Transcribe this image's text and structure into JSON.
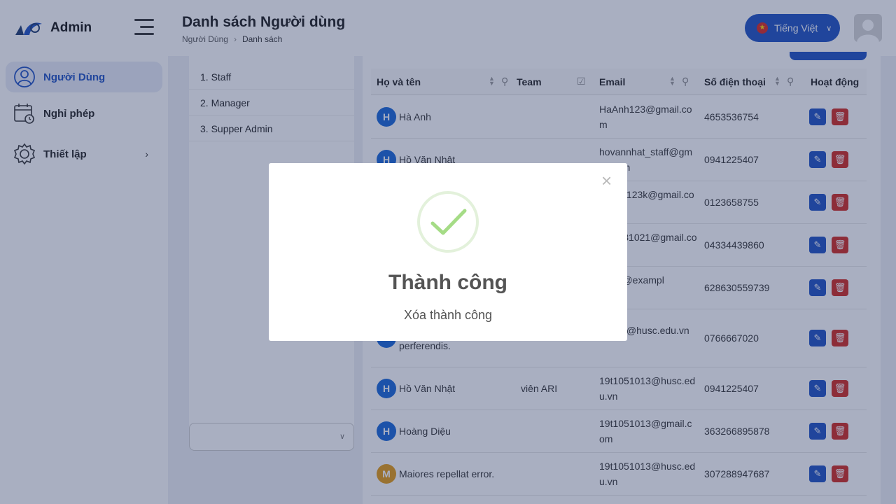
{
  "app": {
    "brand": "Admin"
  },
  "sidebar": {
    "items": [
      {
        "label": "Người Dùng",
        "icon": "user-icon"
      },
      {
        "label": "Nghỉ phép",
        "icon": "calendar-icon"
      },
      {
        "label": "Thiết lập",
        "icon": "gear-icon"
      }
    ]
  },
  "header": {
    "title": "Danh sách Người dùng",
    "breadcrumb": {
      "parent": "Người Dùng",
      "current": "Danh sách"
    },
    "language": "Tiếng Việt"
  },
  "roles": [
    "1. Staff",
    "2. Manager",
    "3. Supper Admin"
  ],
  "table": {
    "columns": [
      "Họ và tên",
      "Team",
      "Email",
      "Số điện thoại",
      "Hoạt động"
    ],
    "rows": [
      {
        "initial": "H",
        "name": "Hà Anh",
        "team": "",
        "email": "HaAnh123@gmail.com",
        "phone": "4653536754"
      },
      {
        "initial": "H",
        "name": "Hồ Văn Nhật",
        "team": "",
        "email": "hovannhat_staff@gmail.com",
        "phone": "0941225407"
      },
      {
        "initial": "",
        "name": "",
        "team": "",
        "email": "nhung123k@gmail.com",
        "phone": "0123658755"
      },
      {
        "initial": "",
        "name": "",
        "team": "",
        "email": "dieu181021@gmail.com",
        "phone": "04334439860"
      },
      {
        "initial": "",
        "name": "",
        "team": "",
        "email": "ibhav@exampl",
        "phone": "628630559739"
      },
      {
        "initial": "",
        "name": "perferendis.",
        "team": "",
        "email": "51013@husc.edu.vn",
        "phone": "0766667020"
      },
      {
        "initial": "H",
        "name": "Hồ Văn Nhật",
        "team": "viên ARI",
        "email": "19t1051013@husc.edu.vn",
        "phone": "0941225407"
      },
      {
        "initial": "H",
        "name": "Hoàng Diệu",
        "team": "",
        "email": "19t1051013@gmail.com",
        "phone": "363266895878"
      },
      {
        "initial": "M",
        "name": "Maiores repellat error.",
        "team": "",
        "email": "19t1051013@husc.edu.vn",
        "phone": "307288947687"
      }
    ]
  },
  "modal": {
    "title": "Thành công",
    "message": "Xóa thành công",
    "close": "×"
  },
  "colors": {
    "primary": "#1c4fc2",
    "danger": "#d0271d",
    "success": "#a5dc86",
    "avatar_blue": "#1565d8",
    "avatar_orange": "#e59a10"
  }
}
